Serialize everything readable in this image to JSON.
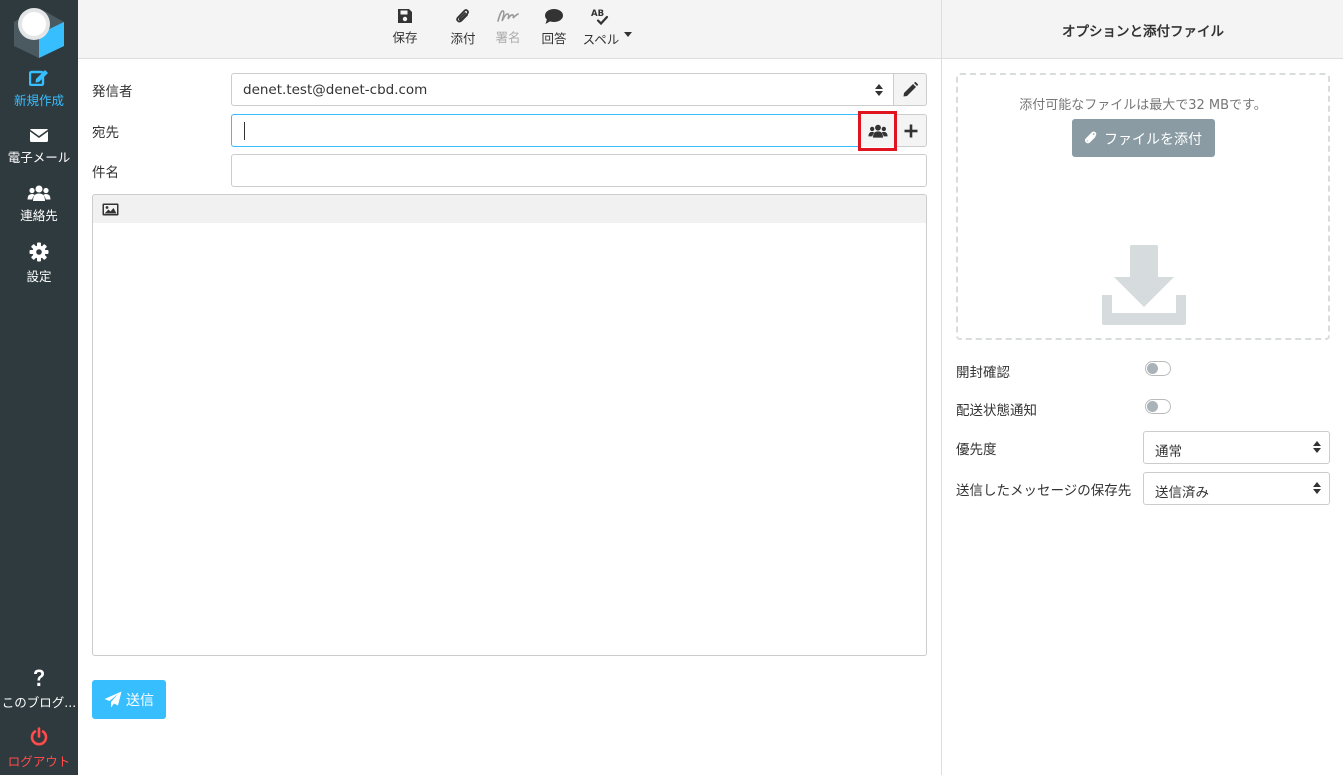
{
  "nav": {
    "items": [
      {
        "label": "新規作成",
        "icon": "compose-icon"
      },
      {
        "label": "電子メール",
        "icon": "envelope-icon"
      },
      {
        "label": "連絡先",
        "icon": "users-icon"
      },
      {
        "label": "設定",
        "icon": "gear-icon"
      }
    ],
    "about_label": "このブログ...",
    "logout_label": "ログアウト"
  },
  "toolbar": {
    "save": "保存",
    "attach": "添付",
    "signature": "署名",
    "responses": "回答",
    "spell": "スペル"
  },
  "compose": {
    "from_label": "発信者",
    "from_value": "denet.test@denet-cbd.com",
    "to_label": "宛先",
    "to_value": "",
    "subject_label": "件名",
    "subject_value": "",
    "send_label": "送信"
  },
  "options": {
    "header": "オプションと添付ファイル",
    "attach_hint": "添付可能なファイルは最大で32 MBです。",
    "attach_button": "ファイルを添付",
    "read_receipt_label": "開封確認",
    "read_receipt_on": false,
    "dsn_label": "配送状態通知",
    "dsn_on": false,
    "priority_label": "優先度",
    "priority_value": "通常",
    "save_sent_label": "送信したメッセージの保存先",
    "save_sent_value": "送信済み"
  },
  "colors": {
    "nav_bg": "#2f3a3f",
    "accent": "#37beff",
    "logout": "#ff4b4b",
    "highlight_box": "#e0141e"
  }
}
